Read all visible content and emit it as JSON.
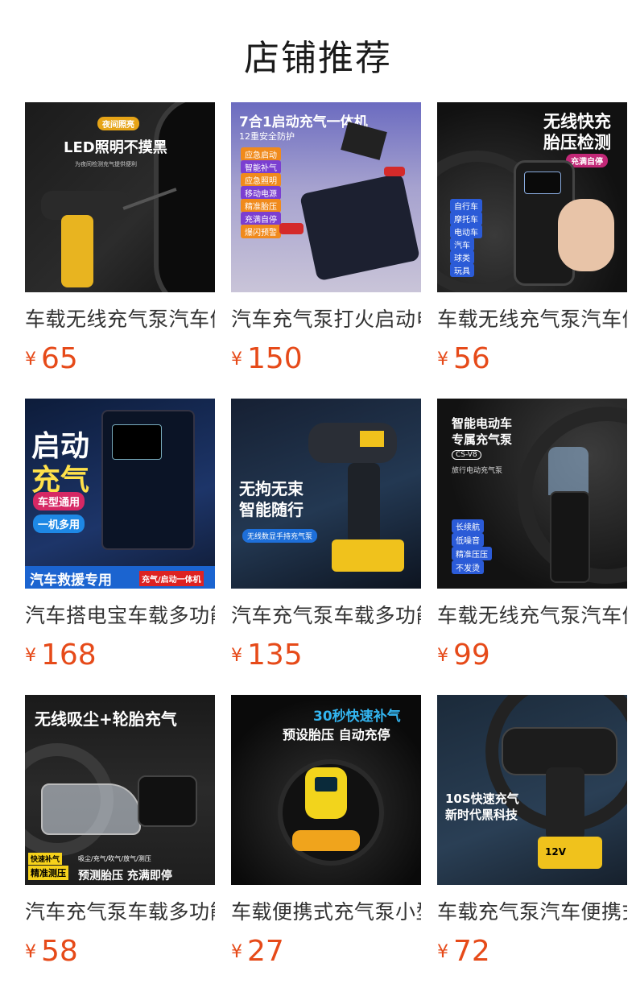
{
  "header": {
    "title": "店铺推荐"
  },
  "products": [
    {
      "name": "车载无线充气泵汽车便携式",
      "currency": "¥",
      "price": "65",
      "image": {
        "subject": "tire-inflator-led",
        "texts": [
          "夜间照亮",
          "LED照明不摸黑",
          "为夜间检测充气提供便利"
        ]
      }
    },
    {
      "name": "汽车充气泵打火启动电源",
      "currency": "¥",
      "price": "150",
      "image": {
        "subject": "jump-starter-inflator",
        "texts": [
          "7合1启动充气一体机",
          "12重安全防护",
          "应急启动",
          "智能补气",
          "应急照明",
          "移动电源",
          "精准胎压",
          "充满自停",
          "爆闪预警"
        ]
      }
    },
    {
      "name": "车载无线充气泵汽车便携式",
      "currency": "¥",
      "price": "56",
      "image": {
        "subject": "handheld-inflator",
        "texts": [
          "无线快充",
          "胎压检测",
          "充满自停",
          "自行车",
          "摩托车",
          "电动车",
          "汽车",
          "球类",
          "玩具"
        ]
      }
    },
    {
      "name": "汽车搭电宝车载多功能",
      "currency": "¥",
      "price": "168",
      "image": {
        "subject": "jump-starter-box",
        "texts": [
          "启动",
          "充气",
          "车型通用",
          "一机多用",
          "汽车救援专用",
          "充气/启动一体机"
        ]
      }
    },
    {
      "name": "汽车充气泵车载多功能",
      "currency": "¥",
      "price": "135",
      "image": {
        "subject": "gun-inflator",
        "texts": [
          "无拘无束",
          "智能随行",
          "无线数显手持充气泵"
        ]
      }
    },
    {
      "name": "车载无线充气泵汽车便携式",
      "currency": "¥",
      "price": "99",
      "image": {
        "subject": "ev-inflator",
        "texts": [
          "智能电动车",
          "专属充气泵",
          "CS-V8",
          "旅行电动充气泵",
          "长续航",
          "低噪音",
          "精准压压",
          "不发烫"
        ]
      }
    },
    {
      "name": "汽车充气泵车载多功能",
      "currency": "¥",
      "price": "58",
      "image": {
        "subject": "vacuum-inflator",
        "texts": [
          "无线吸尘+轮胎充气",
          "快速补气",
          "精准测压",
          "吸尘/充气/吹气/放气/测压",
          "预测胎压 充满即停"
        ]
      }
    },
    {
      "name": "车载便携式充气泵小型",
      "currency": "¥",
      "price": "27",
      "image": {
        "subject": "round-inflator",
        "texts": [
          "30秒快速补气",
          "预设胎压 自动充停"
        ]
      }
    },
    {
      "name": "车载充气泵汽车便携式",
      "currency": "¥",
      "price": "72",
      "image": {
        "subject": "gun-inflator-12v",
        "texts": [
          "10S快速充气",
          "新时代黑科技",
          "12V"
        ]
      }
    }
  ],
  "colors": {
    "price": "#e64a19",
    "title": "#1a1a1a",
    "text": "#333333"
  }
}
